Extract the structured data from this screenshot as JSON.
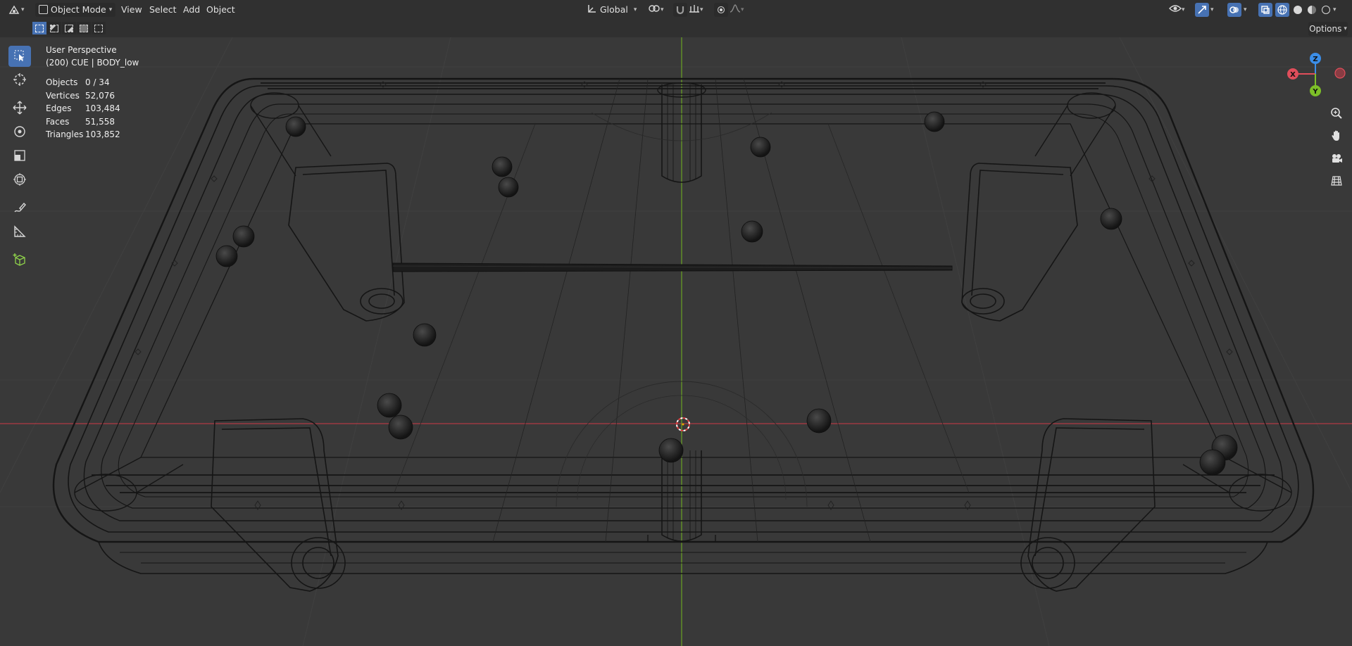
{
  "header": {
    "editor_type_icon": "3d-viewport-icon",
    "mode": "Object Mode",
    "menus": [
      "View",
      "Select",
      "Add",
      "Object"
    ],
    "orientation": "Global",
    "options_label": "Options"
  },
  "viewport": {
    "view_name": "User Perspective",
    "object_info": "(200) CUE | BODY_low",
    "stats": [
      {
        "label": "Objects",
        "value": "0 / 34"
      },
      {
        "label": "Vertices",
        "value": "52,076"
      },
      {
        "label": "Edges",
        "value": "103,484"
      },
      {
        "label": "Faces",
        "value": "51,558"
      },
      {
        "label": "Triangles",
        "value": "103,852"
      }
    ]
  },
  "gizmo": {
    "x_label": "X",
    "y_label": "Y",
    "z_label": "Z"
  },
  "toolbar": {
    "tools": [
      "select-box-icon",
      "cursor-icon",
      "move-icon",
      "rotate-icon",
      "scale-icon",
      "transform-icon",
      "annotate-icon",
      "measure-icon",
      "add-cube-icon"
    ]
  },
  "colors": {
    "accent": "#4772b3",
    "viewport_bg": "#393939",
    "header_bg": "#303030",
    "x_axis": "#e04e5b",
    "y_axis": "#7dbf28",
    "z_axis": "#3b8ee8"
  }
}
